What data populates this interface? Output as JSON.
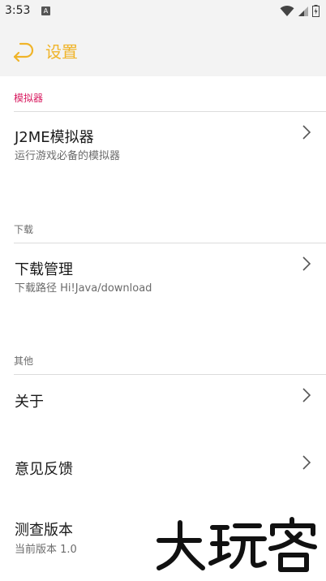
{
  "status_bar": {
    "time": "3:53",
    "notification_icon": "A",
    "icons": [
      "wifi-icon",
      "signal-icon",
      "battery-charging-icon"
    ]
  },
  "app_bar": {
    "back_icon": "back-arrow-icon",
    "title": "设置"
  },
  "colors": {
    "accent": "#f0b429",
    "section_header_emulator": "#d81b60",
    "section_header": "#6b6b6b",
    "subtitle": "#6b6b6b"
  },
  "sections": [
    {
      "header": "模拟器",
      "items": [
        {
          "title": "J2ME模拟器",
          "subtitle": "运行游戏必备的模拟器",
          "chevron": true
        }
      ]
    },
    {
      "header": "下载",
      "items": [
        {
          "title": "下载管理",
          "subtitle": "下载路径 Hi!Java/download",
          "chevron": true
        }
      ]
    },
    {
      "header": "其他",
      "items": [
        {
          "title": "关于",
          "chevron": true
        },
        {
          "title": "意见反馈",
          "chevron": true
        },
        {
          "title": "测查版本",
          "subtitle": "当前版本 1.0",
          "chevron": false
        }
      ]
    }
  ],
  "watermark": "大玩客"
}
